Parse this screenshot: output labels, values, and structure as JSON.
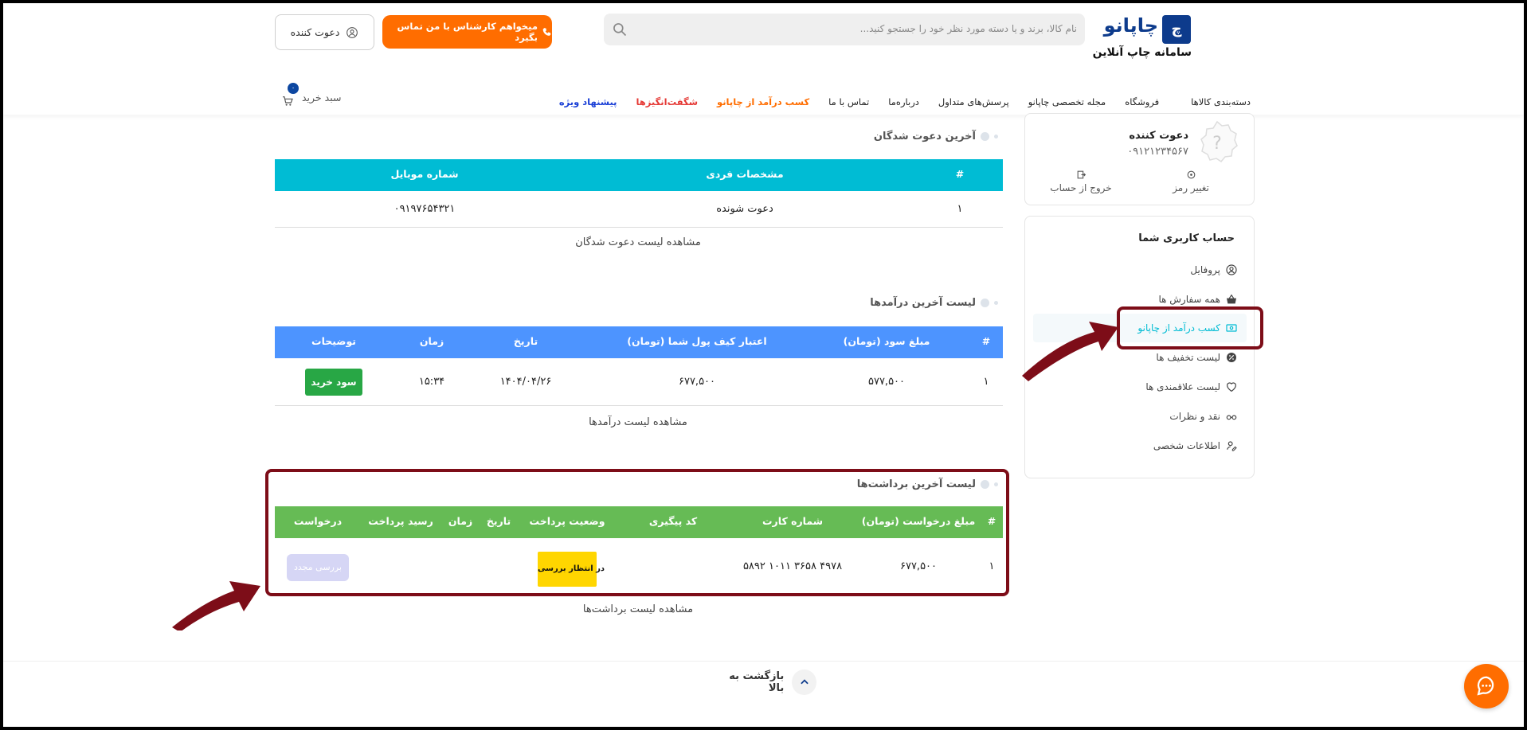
{
  "header": {
    "logo_mark": "چ",
    "logo_name": "چاپانو",
    "logo_subtitle": "سامانه چاپ آنلاین",
    "search_placeholder": "نام کالا، برند و یا دسته مورد نظر خود را جستجو کنید...",
    "call_button": "میخواهم کارشناس با من تماس بگیرد",
    "invite_button": "دعوت کننده",
    "cart_label": "سبد خرید",
    "cart_count": "۰"
  },
  "nav": {
    "items": [
      {
        "label": "دسته‌بندی کالاها",
        "color": "#222222"
      },
      {
        "label": "فروشگاه",
        "color": "#222222"
      },
      {
        "label": "مجله تخصصی چاپانو",
        "color": "#222222"
      },
      {
        "label": "پرسش‌های متداول",
        "color": "#222222"
      },
      {
        "label": "درباره‌ما",
        "color": "#222222"
      },
      {
        "label": "تماس با ما",
        "color": "#222222"
      },
      {
        "label": "کسب درآمد از چاپانو",
        "color": "#ff6d00"
      },
      {
        "label": "شگفت‌انگیزها",
        "color": "#e53935"
      },
      {
        "label": "پیشنهاد ویژه",
        "color": "#1a3fd6"
      }
    ]
  },
  "profile": {
    "name": "دعوت کننده",
    "phone": "۰۹۱۲۱۲۳۴۵۶۷",
    "change_password": "تغییر رمز",
    "logout": "خروج از حساب"
  },
  "account_menu": {
    "title": "حساب کاربری شما",
    "items": [
      {
        "label": "پروفایل",
        "icon": "user-circle-icon"
      },
      {
        "label": "همه سفارش ها",
        "icon": "basket-icon"
      },
      {
        "label": "کسب درآمد از چاپانو",
        "icon": "money-icon"
      },
      {
        "label": "لیست تخفیف ها",
        "icon": "discount-icon"
      },
      {
        "label": "لیست علاقمندی ها",
        "icon": "heart-icon"
      },
      {
        "label": "نقد و نظرات",
        "icon": "glasses-icon"
      },
      {
        "label": "اطلاعات شخصی",
        "icon": "user-edit-icon"
      }
    ],
    "active_color": "#00bcd4"
  },
  "invitees": {
    "title": "آخرین دعوت شدگان",
    "header_color": "#00bcd4",
    "columns": [
      "#",
      "مشخصات فردی",
      "شماره موبایل"
    ],
    "rows": [
      [
        "۱",
        "دعوت شونده",
        "۰۹۱۹۷۶۵۴۳۲۱"
      ]
    ],
    "view_link": "مشاهده لیست دعوت شدگان"
  },
  "incomes": {
    "title": "لیست آخرین درآمدها",
    "header_color": "#4d94ff",
    "columns": [
      "#",
      "مبلغ سود (تومان)",
      "اعتبار کیف پول شما (تومان)",
      "تاریخ",
      "زمان",
      "توضیحات"
    ],
    "rows": [
      [
        "۱",
        "۵۷۷,۵۰۰",
        "۶۷۷,۵۰۰",
        "۱۴۰۴/۰۴/۲۶",
        "۱۵:۳۴",
        "سود خرید"
      ]
    ],
    "badge_color": "#28a745",
    "view_link": "مشاهده لیست درآمدها"
  },
  "withdrawals": {
    "title": "لیست آخرین برداشت‌ها",
    "header_color": "#66bb55",
    "columns": [
      "#",
      "مبلغ درخواست (تومان)",
      "شماره کارت",
      "کد پیگیری",
      "وضعیت پرداخت",
      "تاریخ",
      "زمان",
      "رسید پرداخت",
      "درخواست"
    ],
    "rows": [
      [
        "۱",
        "۶۷۷,۵۰۰",
        "۵۸۹۲ ۱۰۱۱ ۳۶۵۸ ۴۹۷۸",
        "",
        "در انتظار بررسی",
        "",
        "",
        "",
        "بررسی مجدد"
      ]
    ],
    "status_color": "#ffd600",
    "view_link": "مشاهده لیست برداشت‌ها"
  },
  "footer": {
    "back_to_top": "بازگشت به بالا"
  },
  "colors": {
    "annotation": "#7d0d18",
    "chat_button": "#ff6d00"
  }
}
